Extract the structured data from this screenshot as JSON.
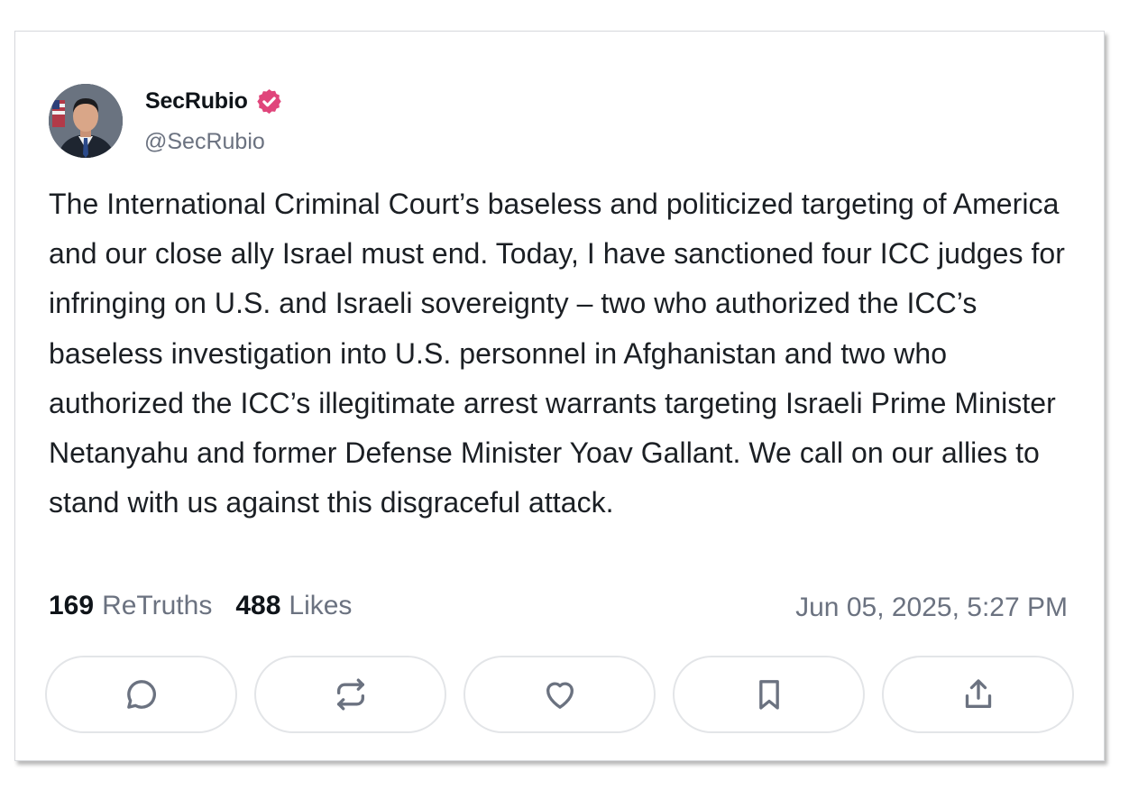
{
  "post": {
    "author": {
      "display_name": "SecRubio",
      "handle": "@SecRubio",
      "verified": true,
      "avatar_icon": "profile-photo"
    },
    "text": "The International Criminal Court’s baseless and politicized targeting of America and our close ally Israel must end. Today, I have sanctioned four ICC judges for infringing on U.S. and Israeli sovereignty – two who authorized the ICC’s baseless investigation into U.S. personnel in Afghanistan and two who authorized the ICC’s illegitimate arrest warrants targeting Israeli Prime Minister Netanyahu and former Defense Minister Yoav Gallant. We call on our allies to stand with us against this disgraceful attack.",
    "stats": {
      "retruths_count": "169",
      "retruths_label": "ReTruths",
      "likes_count": "488",
      "likes_label": "Likes"
    },
    "timestamp": "Jun 05, 2025, 5:27 PM"
  },
  "actions": [
    {
      "name": "reply",
      "icon": "comment-icon"
    },
    {
      "name": "retruth",
      "icon": "repost-icon"
    },
    {
      "name": "like",
      "icon": "heart-icon"
    },
    {
      "name": "bookmark",
      "icon": "bookmark-icon"
    },
    {
      "name": "share",
      "icon": "share-icon"
    }
  ],
  "colors": {
    "verified_badge": "#e0457b",
    "icon_stroke": "#6b7280",
    "text_primary": "#0f1419",
    "text_secondary": "#6b7280"
  }
}
